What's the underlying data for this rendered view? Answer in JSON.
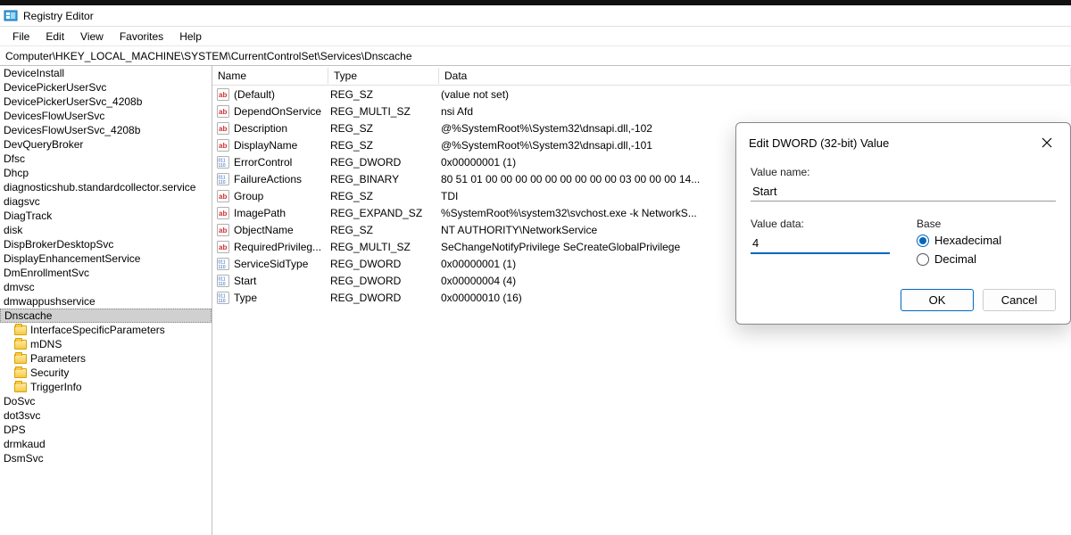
{
  "title": "Registry Editor",
  "menus": [
    "File",
    "Edit",
    "View",
    "Favorites",
    "Help"
  ],
  "address": "Computer\\HKEY_LOCAL_MACHINE\\SYSTEM\\CurrentControlSet\\Services\\Dnscache",
  "tree": [
    {
      "label": "DeviceInstall",
      "kind": "key"
    },
    {
      "label": "DevicePickerUserSvc",
      "kind": "key"
    },
    {
      "label": "DevicePickerUserSvc_4208b",
      "kind": "key"
    },
    {
      "label": "DevicesFlowUserSvc",
      "kind": "key"
    },
    {
      "label": "DevicesFlowUserSvc_4208b",
      "kind": "key"
    },
    {
      "label": "DevQueryBroker",
      "kind": "key"
    },
    {
      "label": "Dfsc",
      "kind": "key"
    },
    {
      "label": "Dhcp",
      "kind": "key"
    },
    {
      "label": "diagnosticshub.standardcollector.service",
      "kind": "key"
    },
    {
      "label": "diagsvc",
      "kind": "key"
    },
    {
      "label": "DiagTrack",
      "kind": "key"
    },
    {
      "label": "disk",
      "kind": "key"
    },
    {
      "label": "DispBrokerDesktopSvc",
      "kind": "key"
    },
    {
      "label": "DisplayEnhancementService",
      "kind": "key"
    },
    {
      "label": "DmEnrollmentSvc",
      "kind": "key"
    },
    {
      "label": "dmvsc",
      "kind": "key"
    },
    {
      "label": "dmwappushservice",
      "kind": "key"
    },
    {
      "label": "Dnscache",
      "kind": "key",
      "selected": true
    },
    {
      "label": "InterfaceSpecificParameters",
      "kind": "folder"
    },
    {
      "label": "mDNS",
      "kind": "folder"
    },
    {
      "label": "Parameters",
      "kind": "folder"
    },
    {
      "label": "Security",
      "kind": "folder"
    },
    {
      "label": "TriggerInfo",
      "kind": "folder"
    },
    {
      "label": "DoSvc",
      "kind": "key"
    },
    {
      "label": "dot3svc",
      "kind": "key"
    },
    {
      "label": "DPS",
      "kind": "key"
    },
    {
      "label": "drmkaud",
      "kind": "key"
    },
    {
      "label": "DsmSvc",
      "kind": "key"
    }
  ],
  "columns": {
    "name": "Name",
    "type": "Type",
    "data": "Data"
  },
  "values": [
    {
      "icon": "sz",
      "name": "(Default)",
      "type": "REG_SZ",
      "data": "(value not set)"
    },
    {
      "icon": "sz",
      "name": "DependOnService",
      "type": "REG_MULTI_SZ",
      "data": "nsi Afd"
    },
    {
      "icon": "sz",
      "name": "Description",
      "type": "REG_SZ",
      "data": "@%SystemRoot%\\System32\\dnsapi.dll,-102"
    },
    {
      "icon": "sz",
      "name": "DisplayName",
      "type": "REG_SZ",
      "data": "@%SystemRoot%\\System32\\dnsapi.dll,-101"
    },
    {
      "icon": "bin",
      "name": "ErrorControl",
      "type": "REG_DWORD",
      "data": "0x00000001 (1)"
    },
    {
      "icon": "bin",
      "name": "FailureActions",
      "type": "REG_BINARY",
      "data": "80 51 01 00 00 00 00 00 00 00 00 00 03 00 00 00 14..."
    },
    {
      "icon": "sz",
      "name": "Group",
      "type": "REG_SZ",
      "data": "TDI"
    },
    {
      "icon": "sz",
      "name": "ImagePath",
      "type": "REG_EXPAND_SZ",
      "data": "%SystemRoot%\\system32\\svchost.exe -k NetworkS..."
    },
    {
      "icon": "sz",
      "name": "ObjectName",
      "type": "REG_SZ",
      "data": "NT AUTHORITY\\NetworkService"
    },
    {
      "icon": "sz",
      "name": "RequiredPrivileg...",
      "type": "REG_MULTI_SZ",
      "data": "SeChangeNotifyPrivilege SeCreateGlobalPrivilege"
    },
    {
      "icon": "bin",
      "name": "ServiceSidType",
      "type": "REG_DWORD",
      "data": "0x00000001 (1)"
    },
    {
      "icon": "bin",
      "name": "Start",
      "type": "REG_DWORD",
      "data": "0x00000004 (4)"
    },
    {
      "icon": "bin",
      "name": "Type",
      "type": "REG_DWORD",
      "data": "0x00000010 (16)"
    }
  ],
  "dialog": {
    "title": "Edit DWORD (32-bit) Value",
    "value_name_label": "Value name:",
    "value_name": "Start",
    "value_data_label": "Value data:",
    "value_data": "4",
    "base_label": "Base",
    "hex_label": "Hexadecimal",
    "dec_label": "Decimal",
    "ok": "OK",
    "cancel": "Cancel"
  }
}
